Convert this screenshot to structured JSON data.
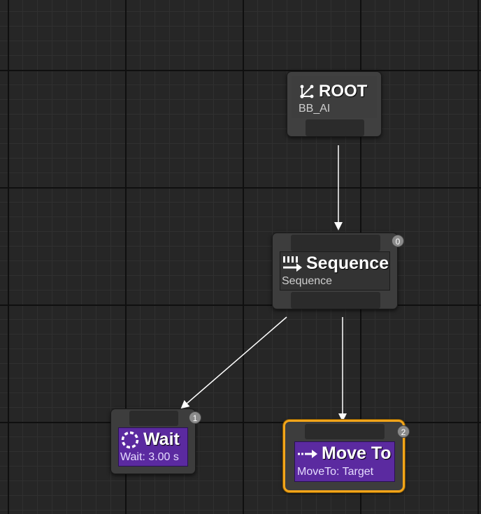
{
  "graph": {
    "nodes": {
      "root": {
        "title": "ROOT",
        "subtitle": "BB_AI",
        "icon": "branch-icon"
      },
      "sequence": {
        "title": "Sequence",
        "subtitle": "Sequence",
        "order": "0",
        "icon": "sequence-icon"
      },
      "wait": {
        "title": "Wait",
        "subtitle": "Wait: 3.00 s",
        "order": "1",
        "icon": "wait-icon"
      },
      "move_to": {
        "title": "Move To",
        "subtitle": "MoveTo: Target",
        "order": "2",
        "icon": "move-to-icon",
        "selected": true
      }
    }
  },
  "colors": {
    "background": "#262626",
    "node": "#3d3d3d",
    "task": "#5b2aa0",
    "selection": "#f2a51a",
    "badge": "#8a8a8a",
    "wire": "#ffffff"
  }
}
